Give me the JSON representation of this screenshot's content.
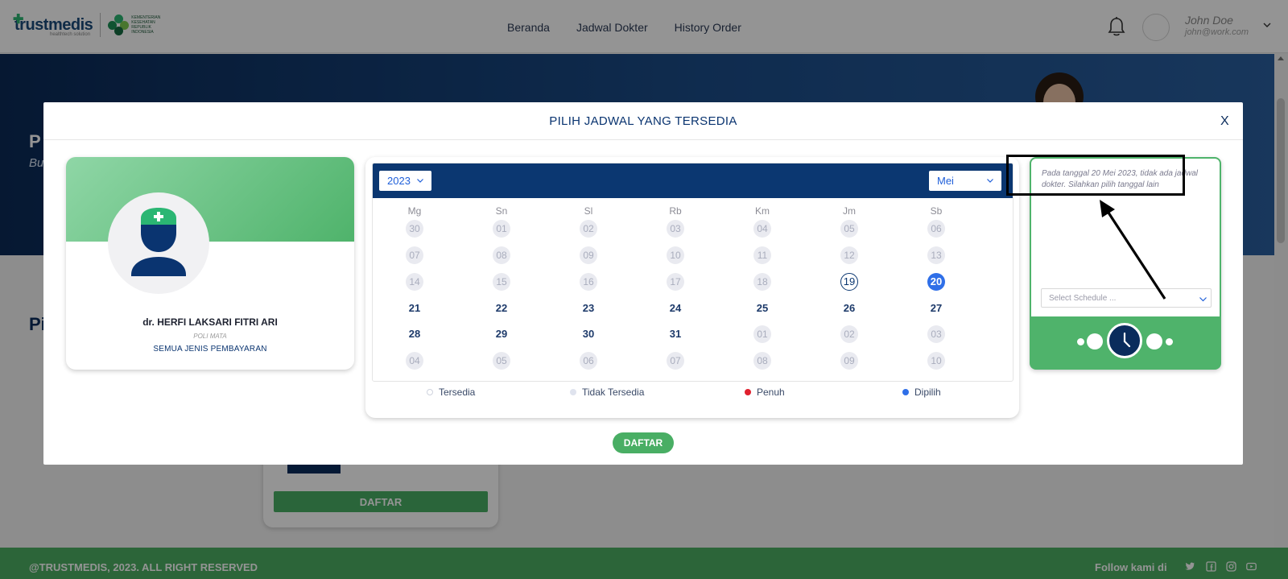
{
  "header": {
    "brand": "trustmedis",
    "brand_tagline": "healthtech solution",
    "partner_text": "KEMENTERIAN KESEHATAN REPUBLIK INDONESIA",
    "nav": [
      "Beranda",
      "Jadwal Dokter",
      "History Order"
    ],
    "user_name": "John Doe",
    "user_email": "john@work.com"
  },
  "hero": {
    "title": "P",
    "subtitle": "Bu"
  },
  "section": {
    "title": "Pi"
  },
  "background_card": {
    "daftar_label": "DAFTAR"
  },
  "footer": {
    "copyright": "@TRUSTMEDIS, 2023. ALL RIGHT RESERVED",
    "follow": "Follow kami di",
    "social_icons": [
      "twitter-icon",
      "facebook-icon",
      "instagram-icon",
      "youtube-icon"
    ]
  },
  "modal": {
    "title": "PILIH JADWAL YANG TERSEDIA",
    "close_label": "X",
    "doctor": {
      "name": "dr. HERFI LAKSARI FITRI ARI",
      "poli": "POLI MATA",
      "payment": "SEMUA JENIS PEMBAYARAN"
    },
    "calendar": {
      "year": "2023",
      "month": "Mei",
      "weekdays": [
        "Mg",
        "Sn",
        "Sl",
        "Rb",
        "Km",
        "Jm",
        "Sb"
      ],
      "weeks": [
        [
          {
            "d": "30",
            "s": "na"
          },
          {
            "d": "01",
            "s": "na"
          },
          {
            "d": "02",
            "s": "na"
          },
          {
            "d": "03",
            "s": "na"
          },
          {
            "d": "04",
            "s": "na"
          },
          {
            "d": "05",
            "s": "na"
          },
          {
            "d": "06",
            "s": "na"
          }
        ],
        [
          {
            "d": "07",
            "s": "na"
          },
          {
            "d": "08",
            "s": "na"
          },
          {
            "d": "09",
            "s": "na"
          },
          {
            "d": "10",
            "s": "na"
          },
          {
            "d": "11",
            "s": "na"
          },
          {
            "d": "12",
            "s": "na"
          },
          {
            "d": "13",
            "s": "na"
          }
        ],
        [
          {
            "d": "14",
            "s": "na"
          },
          {
            "d": "15",
            "s": "na"
          },
          {
            "d": "16",
            "s": "na"
          },
          {
            "d": "17",
            "s": "na"
          },
          {
            "d": "18",
            "s": "na"
          },
          {
            "d": "19",
            "s": "today"
          },
          {
            "d": "20",
            "s": "sel"
          }
        ],
        [
          {
            "d": "21",
            "s": "avail"
          },
          {
            "d": "22",
            "s": "avail"
          },
          {
            "d": "23",
            "s": "avail"
          },
          {
            "d": "24",
            "s": "avail"
          },
          {
            "d": "25",
            "s": "avail"
          },
          {
            "d": "26",
            "s": "avail"
          },
          {
            "d": "27",
            "s": "avail"
          }
        ],
        [
          {
            "d": "28",
            "s": "avail"
          },
          {
            "d": "29",
            "s": "avail"
          },
          {
            "d": "30",
            "s": "avail"
          },
          {
            "d": "31",
            "s": "avail"
          },
          {
            "d": "01",
            "s": "na"
          },
          {
            "d": "02",
            "s": "na"
          },
          {
            "d": "03",
            "s": "na"
          }
        ],
        [
          {
            "d": "04",
            "s": "na"
          },
          {
            "d": "05",
            "s": "na"
          },
          {
            "d": "06",
            "s": "na"
          },
          {
            "d": "07",
            "s": "na"
          },
          {
            "d": "08",
            "s": "na"
          },
          {
            "d": "09",
            "s": "na"
          },
          {
            "d": "10",
            "s": "na"
          }
        ]
      ],
      "legend": [
        {
          "label": "Tersedia",
          "color": "#ffffff"
        },
        {
          "label": "Tidak Tersedia",
          "color": "#dfe3ee"
        },
        {
          "label": "Penuh",
          "color": "#e0202e"
        },
        {
          "label": "Dipilih",
          "color": "#2f6fe8"
        }
      ]
    },
    "schedule": {
      "message": "Pada tanggal 20 Mei 2023, tidak ada jadwal dokter. Silahkan pilih tanggal lain",
      "select_placeholder": "Select Schedule ..."
    },
    "daftar_label": "DAFTAR"
  },
  "colors": {
    "primary": "#0b3771",
    "accent": "#49ae64",
    "selected": "#2f6fe8"
  }
}
